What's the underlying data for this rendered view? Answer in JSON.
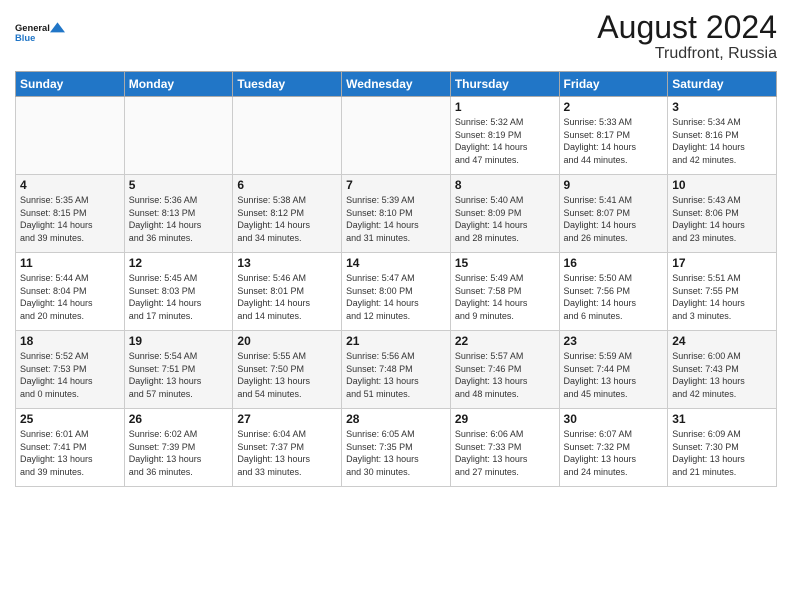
{
  "header": {
    "logo_line1": "General",
    "logo_line2": "Blue",
    "main_title": "August 2024",
    "subtitle": "Trudfront, Russia"
  },
  "days_of_week": [
    "Sunday",
    "Monday",
    "Tuesday",
    "Wednesday",
    "Thursday",
    "Friday",
    "Saturday"
  ],
  "weeks": [
    [
      {
        "day": "",
        "info": ""
      },
      {
        "day": "",
        "info": ""
      },
      {
        "day": "",
        "info": ""
      },
      {
        "day": "",
        "info": ""
      },
      {
        "day": "1",
        "info": "Sunrise: 5:32 AM\nSunset: 8:19 PM\nDaylight: 14 hours\nand 47 minutes."
      },
      {
        "day": "2",
        "info": "Sunrise: 5:33 AM\nSunset: 8:17 PM\nDaylight: 14 hours\nand 44 minutes."
      },
      {
        "day": "3",
        "info": "Sunrise: 5:34 AM\nSunset: 8:16 PM\nDaylight: 14 hours\nand 42 minutes."
      }
    ],
    [
      {
        "day": "4",
        "info": "Sunrise: 5:35 AM\nSunset: 8:15 PM\nDaylight: 14 hours\nand 39 minutes."
      },
      {
        "day": "5",
        "info": "Sunrise: 5:36 AM\nSunset: 8:13 PM\nDaylight: 14 hours\nand 36 minutes."
      },
      {
        "day": "6",
        "info": "Sunrise: 5:38 AM\nSunset: 8:12 PM\nDaylight: 14 hours\nand 34 minutes."
      },
      {
        "day": "7",
        "info": "Sunrise: 5:39 AM\nSunset: 8:10 PM\nDaylight: 14 hours\nand 31 minutes."
      },
      {
        "day": "8",
        "info": "Sunrise: 5:40 AM\nSunset: 8:09 PM\nDaylight: 14 hours\nand 28 minutes."
      },
      {
        "day": "9",
        "info": "Sunrise: 5:41 AM\nSunset: 8:07 PM\nDaylight: 14 hours\nand 26 minutes."
      },
      {
        "day": "10",
        "info": "Sunrise: 5:43 AM\nSunset: 8:06 PM\nDaylight: 14 hours\nand 23 minutes."
      }
    ],
    [
      {
        "day": "11",
        "info": "Sunrise: 5:44 AM\nSunset: 8:04 PM\nDaylight: 14 hours\nand 20 minutes."
      },
      {
        "day": "12",
        "info": "Sunrise: 5:45 AM\nSunset: 8:03 PM\nDaylight: 14 hours\nand 17 minutes."
      },
      {
        "day": "13",
        "info": "Sunrise: 5:46 AM\nSunset: 8:01 PM\nDaylight: 14 hours\nand 14 minutes."
      },
      {
        "day": "14",
        "info": "Sunrise: 5:47 AM\nSunset: 8:00 PM\nDaylight: 14 hours\nand 12 minutes."
      },
      {
        "day": "15",
        "info": "Sunrise: 5:49 AM\nSunset: 7:58 PM\nDaylight: 14 hours\nand 9 minutes."
      },
      {
        "day": "16",
        "info": "Sunrise: 5:50 AM\nSunset: 7:56 PM\nDaylight: 14 hours\nand 6 minutes."
      },
      {
        "day": "17",
        "info": "Sunrise: 5:51 AM\nSunset: 7:55 PM\nDaylight: 14 hours\nand 3 minutes."
      }
    ],
    [
      {
        "day": "18",
        "info": "Sunrise: 5:52 AM\nSunset: 7:53 PM\nDaylight: 14 hours\nand 0 minutes."
      },
      {
        "day": "19",
        "info": "Sunrise: 5:54 AM\nSunset: 7:51 PM\nDaylight: 13 hours\nand 57 minutes."
      },
      {
        "day": "20",
        "info": "Sunrise: 5:55 AM\nSunset: 7:50 PM\nDaylight: 13 hours\nand 54 minutes."
      },
      {
        "day": "21",
        "info": "Sunrise: 5:56 AM\nSunset: 7:48 PM\nDaylight: 13 hours\nand 51 minutes."
      },
      {
        "day": "22",
        "info": "Sunrise: 5:57 AM\nSunset: 7:46 PM\nDaylight: 13 hours\nand 48 minutes."
      },
      {
        "day": "23",
        "info": "Sunrise: 5:59 AM\nSunset: 7:44 PM\nDaylight: 13 hours\nand 45 minutes."
      },
      {
        "day": "24",
        "info": "Sunrise: 6:00 AM\nSunset: 7:43 PM\nDaylight: 13 hours\nand 42 minutes."
      }
    ],
    [
      {
        "day": "25",
        "info": "Sunrise: 6:01 AM\nSunset: 7:41 PM\nDaylight: 13 hours\nand 39 minutes."
      },
      {
        "day": "26",
        "info": "Sunrise: 6:02 AM\nSunset: 7:39 PM\nDaylight: 13 hours\nand 36 minutes."
      },
      {
        "day": "27",
        "info": "Sunrise: 6:04 AM\nSunset: 7:37 PM\nDaylight: 13 hours\nand 33 minutes."
      },
      {
        "day": "28",
        "info": "Sunrise: 6:05 AM\nSunset: 7:35 PM\nDaylight: 13 hours\nand 30 minutes."
      },
      {
        "day": "29",
        "info": "Sunrise: 6:06 AM\nSunset: 7:33 PM\nDaylight: 13 hours\nand 27 minutes."
      },
      {
        "day": "30",
        "info": "Sunrise: 6:07 AM\nSunset: 7:32 PM\nDaylight: 13 hours\nand 24 minutes."
      },
      {
        "day": "31",
        "info": "Sunrise: 6:09 AM\nSunset: 7:30 PM\nDaylight: 13 hours\nand 21 minutes."
      }
    ]
  ]
}
